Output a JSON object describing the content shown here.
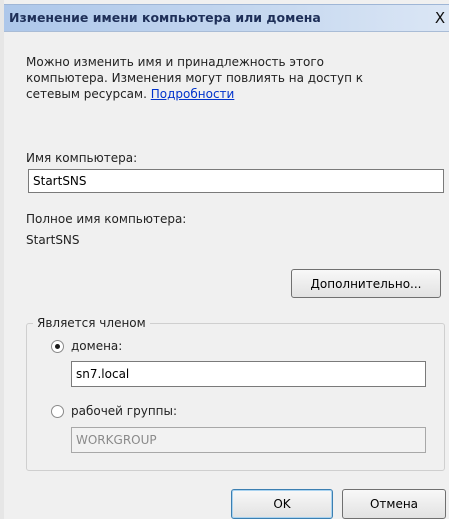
{
  "window": {
    "title": "Изменение имени компьютера или домена",
    "close_glyph": "X"
  },
  "description": {
    "line1": "Можно изменить имя и принадлежность этого",
    "line2": "компьютера. Изменения могут повлиять на доступ к",
    "line3_prefix": "сетевым ресурсам.",
    "details_link": "Подробности"
  },
  "computer_name": {
    "label": "Имя компьютера:",
    "value": "StartSNS"
  },
  "full_name": {
    "label": "Полное имя компьютера:",
    "value": "StartSNS"
  },
  "more_button": {
    "label": "Дополнительно..."
  },
  "member_of": {
    "legend": "Является членом",
    "domain": {
      "label": "домена:",
      "value": "sn7.local",
      "selected": true
    },
    "workgroup": {
      "label": "рабочей группы:",
      "value": "WORKGROUP",
      "selected": false
    }
  },
  "buttons": {
    "ok": "OK",
    "cancel": "Отмена"
  }
}
